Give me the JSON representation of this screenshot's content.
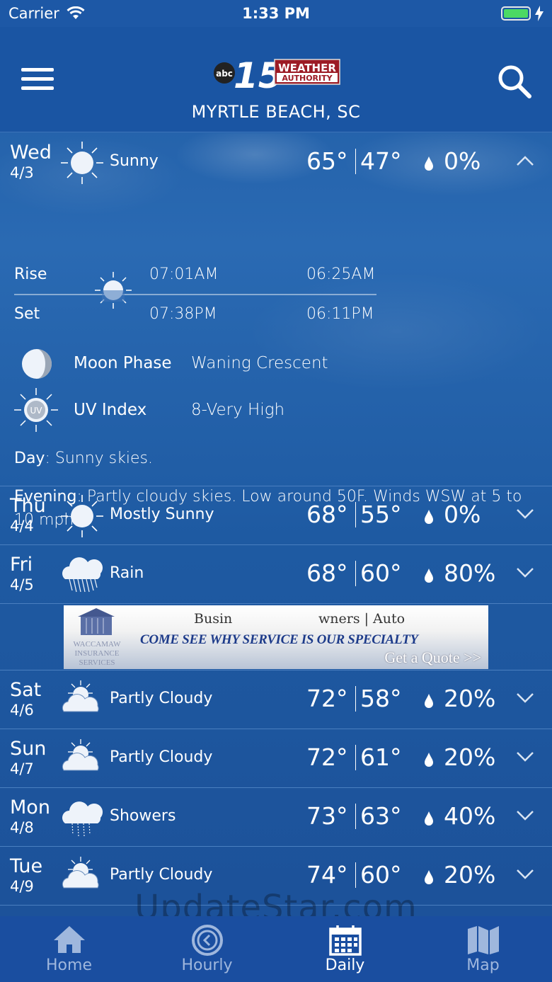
{
  "status_bar": {
    "carrier": "Carrier",
    "time": "1:33 PM"
  },
  "header": {
    "logo": {
      "network": "abc",
      "channel": "15",
      "brand_line1": "WEATHER",
      "brand_line2": "AUTHORITY"
    },
    "location": "MYRTLE BEACH, SC",
    "icons": {
      "menu": "hamburger-menu-icon",
      "search": "search-icon"
    }
  },
  "expanded_day": {
    "day": "Wed",
    "date": "4/3",
    "condition": "Sunny",
    "icon": "sun-icon",
    "high": "65°",
    "low": "47°",
    "precip": "0%",
    "rise_label": "Rise",
    "set_label": "Set",
    "sunrise": "07:01AM",
    "sunset": "07:38PM",
    "moonrise": "06:25AM",
    "moonset": "06:11PM",
    "moon_phase_label": "Moon Phase",
    "moon_phase_value": "Waning Crescent",
    "uv_label": "UV Index",
    "uv_value": "8-Very High",
    "uv_icon_text": "UV",
    "day_label": "Day",
    "day_text": ": Sunny skies.",
    "evening_label": "Evening",
    "evening_text": ": Partly cloudy skies. Low around 50F. Winds WSW at 5 to 10 mph."
  },
  "days": [
    {
      "day": "Thu",
      "date": "4/4",
      "condition": "Mostly Sunny",
      "icon": "sun-icon",
      "high": "68°",
      "low": "55°",
      "precip": "0%"
    },
    {
      "day": "Fri",
      "date": "4/5",
      "condition": "Rain",
      "icon": "rain-icon",
      "high": "68°",
      "low": "60°",
      "precip": "80%"
    },
    {
      "day": "Sat",
      "date": "4/6",
      "condition": "Partly Cloudy",
      "icon": "partly-cloudy-icon",
      "high": "72°",
      "low": "58°",
      "precip": "20%"
    },
    {
      "day": "Sun",
      "date": "4/7",
      "condition": "Partly Cloudy",
      "icon": "partly-cloudy-icon",
      "high": "72°",
      "low": "61°",
      "precip": "20%"
    },
    {
      "day": "Mon",
      "date": "4/8",
      "condition": "Showers",
      "icon": "showers-icon",
      "high": "73°",
      "low": "63°",
      "precip": "40%"
    },
    {
      "day": "Tue",
      "date": "4/9",
      "condition": "Partly Cloudy",
      "icon": "partly-cloudy-icon",
      "high": "74°",
      "low": "60°",
      "precip": "20%"
    }
  ],
  "ad": {
    "logo_lines": [
      "WACCAMAW",
      "INSURANCE",
      "SERVICES"
    ],
    "top_left": "Busin",
    "top_right": "wners | Auto",
    "main": "COME SEE WHY SERVICE IS OUR SPECIALTY",
    "cta": "Get a Quote >>"
  },
  "watermark": "UpdateStar.com",
  "tabs": [
    {
      "label": "Home",
      "icon": "home-icon",
      "active": false
    },
    {
      "label": "Hourly",
      "icon": "clock-icon",
      "active": false
    },
    {
      "label": "Daily",
      "icon": "calendar-icon",
      "active": true
    },
    {
      "label": "Map",
      "icon": "map-icon",
      "active": false
    }
  ],
  "colors": {
    "header": "#1a55a3",
    "tab_bar": "#1a4ea0",
    "battery": "#4cd964"
  }
}
